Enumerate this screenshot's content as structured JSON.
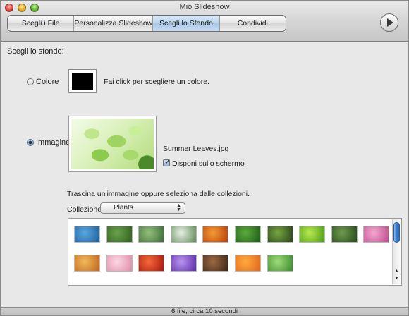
{
  "window": {
    "title": "Mio Slideshow"
  },
  "toolbar": {
    "segments": [
      {
        "label": "Scegli i File"
      },
      {
        "label": "Personalizza Slideshow"
      },
      {
        "label": "Scegli lo Sfondo",
        "selected": true
      },
      {
        "label": "Condividi"
      }
    ],
    "play_icon": "play-icon"
  },
  "background": {
    "section_title": "Scegli lo sfondo:",
    "color_option": {
      "label": "Colore",
      "selected": false,
      "swatch_color": "#000000",
      "hint": "Fai click per scegliere un colore."
    },
    "image_option": {
      "label": "Immagine",
      "selected": true,
      "filename": "Summer Leaves.jpg",
      "fit_checkbox_label": "Disponi sullo schermo",
      "fit_checked": true
    },
    "drag_hint": "Trascina un'immagine oppure seleziona dalle collezioni.",
    "collection_label": "Collezione:",
    "collection_selected": "Plants",
    "thumbnails": [
      {
        "name": "blue-agave",
        "c1": "#5aa7e0",
        "c2": "#1f5f9a"
      },
      {
        "name": "bamboo",
        "c1": "#6aa24a",
        "c2": "#2f5f1e"
      },
      {
        "name": "leaves-dew",
        "c1": "#93c07a",
        "c2": "#3c6b39"
      },
      {
        "name": "dandelion",
        "c1": "#e8efe5",
        "c2": "#5c8a53"
      },
      {
        "name": "orange-flower",
        "c1": "#f59a32",
        "c2": "#b43f0c"
      },
      {
        "name": "grass",
        "c1": "#5cab3c",
        "c2": "#1d5a17"
      },
      {
        "name": "forest-grass",
        "c1": "#77a53f",
        "c2": "#26421a"
      },
      {
        "name": "green-leaf",
        "c1": "#b6ea4e",
        "c2": "#4b9918"
      },
      {
        "name": "ferns",
        "c1": "#6f9a4f",
        "c2": "#244a1a"
      },
      {
        "name": "pink-lotus",
        "c1": "#f5a6cf",
        "c2": "#b94c8c"
      },
      {
        "name": "autumn-leaf",
        "c1": "#f0b95a",
        "c2": "#c0651c"
      },
      {
        "name": "cherry-blossom",
        "c1": "#fbd7e4",
        "c2": "#e08aa8"
      },
      {
        "name": "red-rose",
        "c1": "#f46a3a",
        "c2": "#a8150d"
      },
      {
        "name": "purple-petals",
        "c1": "#b894ef",
        "c2": "#5b2aa8"
      },
      {
        "name": "redwood-trunks",
        "c1": "#9c6a44",
        "c2": "#3d2414"
      },
      {
        "name": "orange-petal",
        "c1": "#ffaa3e",
        "c2": "#e0661a"
      },
      {
        "name": "green-mesh",
        "c1": "#9edb7a",
        "c2": "#3a8a2a"
      }
    ]
  },
  "status": {
    "text": "6 file, circa 10 secondi"
  }
}
